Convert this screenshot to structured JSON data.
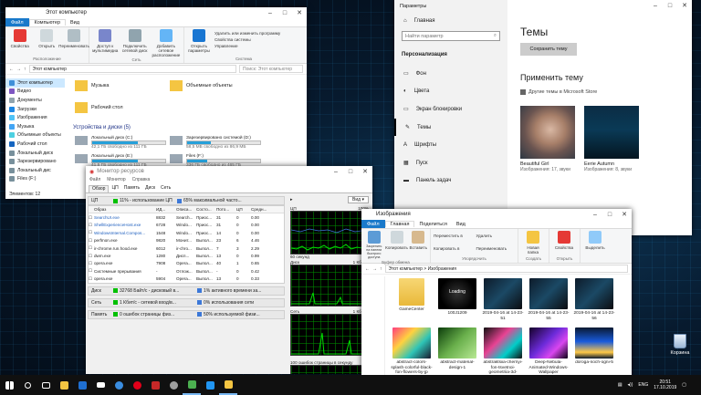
{
  "explorer1": {
    "title": "Этот компьютер",
    "tabs": [
      "Файл",
      "Компьютер",
      "Вид"
    ],
    "ribbon": {
      "location_items": [
        "Свойства",
        "Открыть",
        "Переименовать"
      ],
      "location_label": "Расположение",
      "net_items": [
        "Доступ к мультимедиа",
        "Подключить сетевой диск",
        "Добавить сетевое расположение"
      ],
      "net_label": "Сеть",
      "sys_open": "Открыть параметры",
      "sys_items": [
        "Удалить или изменить программу",
        "Свойства системы",
        "Управление"
      ],
      "sys_label": "Система"
    },
    "address": "Этот компьютер",
    "search_placeholder": "Поиск: Этот компьютер",
    "nav": [
      "Этот компьютер",
      "Видео",
      "Документы",
      "Загрузки",
      "Изображения",
      "Музыка",
      "Объемные объекты",
      "Рабочий стол",
      "Локальный диск",
      "Зарезервировано",
      "Локальный дис",
      "Files (F:)"
    ],
    "folders": [
      "Музыка",
      "Объемные объекты",
      "Рабочий стол"
    ],
    "devices_header": "Устройства и диски (5)",
    "drives": [
      {
        "name": "Локальный диск (C:)",
        "free": "42,1 ГБ свободно из 111 ГБ",
        "fill": 0.62
      },
      {
        "name": "Зарезервировано системой (D:)",
        "free": "58,5 МБ свободно из 86,9 МБ",
        "fill": 0.33
      },
      {
        "name": "Локальный диск (E:)",
        "free": "41,5 ГБ свободно из 111 ГБ",
        "fill": 0.63
      },
      {
        "name": "Files (F:)",
        "free": "336 ГБ свободно из 465 ГБ",
        "fill": 0.28
      }
    ],
    "status": "Элементов: 12"
  },
  "settings": {
    "title": "Параметры",
    "home": "Главная",
    "search_placeholder": "Найти параметр",
    "section": "Персонализация",
    "items": [
      "Фон",
      "Цвета",
      "Экран блокировки",
      "Темы",
      "Шрифты",
      "Пуск",
      "Панель задач"
    ],
    "heading": "Темы",
    "save_button": "Сохранить тему",
    "apply_heading": "Применить тему",
    "store_link": "Другие темы в Microsoft Store",
    "themes": [
      {
        "name": "Beautiful Girl",
        "sub": "Изображения: 17, звуки"
      },
      {
        "name": "Eerie Autumn",
        "sub": "Изображения: 8, звуки"
      }
    ]
  },
  "resmon": {
    "title": "Монитор ресурсов",
    "menu": [
      "Файл",
      "Монитор",
      "Справка"
    ],
    "tabs": [
      "Обзор",
      "ЦП",
      "Память",
      "Диск",
      "Сеть"
    ],
    "cpu_header": {
      "name": "ЦП",
      "usage": "11% - использование ЦП",
      "freq": "65% максимальной часто..."
    },
    "columns": [
      "Образ",
      "ИД...",
      "Описа...",
      "Состо...",
      "Пото...",
      "ЦП",
      "Средн..."
    ],
    "processes": [
      [
        "SearchUI.exe",
        "8832",
        "Search...",
        "Приос...",
        "31",
        "0",
        "0.00"
      ],
      [
        "ShellExperienceHost.exe",
        "6728",
        "Windo...",
        "Приос...",
        "31",
        "0",
        "0.00"
      ],
      [
        "WindowsInternal.Compos...",
        "1548",
        "Windo...",
        "Приос...",
        "14",
        "0",
        "0.00"
      ],
      [
        "perfmon.exe",
        "9820",
        "Монит...",
        "Выпол...",
        "23",
        "6",
        "4.46"
      ],
      [
        "ir-chrome.run.hood.exe",
        "6012",
        "ir-chro...",
        "Выпол...",
        "7",
        "3",
        "2.29"
      ],
      [
        "dwm.exe",
        "1280",
        "Дисп...",
        "Выпол...",
        "13",
        "0",
        "0.99"
      ],
      [
        "opera.exe",
        "7908",
        "Opera...",
        "Выпол...",
        "40",
        "1",
        "0.65"
      ],
      [
        "Системные прерывания",
        "-",
        "Отлож...",
        "Выпол...",
        "-",
        "0",
        "0.42"
      ],
      [
        "opera.exe",
        "5904",
        "Opera...",
        "Выпол...",
        "13",
        "0",
        "0.33"
      ]
    ],
    "disk_header": {
      "name": "Диск",
      "io": "32768 Байт/с - дисковый в...",
      "active": "1% активного времени за..."
    },
    "net_header": {
      "name": "Сеть",
      "io": "1 Кбит/с - сетевой вход/в...",
      "usage": "0% использования сети"
    },
    "mem_header": {
      "name": "Память",
      "faults": "0 ошибок страницы физ...",
      "used": "50% используемой физи..."
    },
    "view_button": "Вид",
    "graphs": [
      {
        "label": "ЦП",
        "max": "100%",
        "foot": "60 секунд",
        "end": "0%"
      },
      {
        "label": "Диск",
        "max": "1 Кбит/с",
        "foot": "",
        "end": ""
      },
      {
        "label": "Сеть",
        "max": "1 Кбит/с",
        "foot": "",
        "end": "0"
      },
      {
        "label": "100 ошибок страницы в секунду",
        "max": "",
        "foot": "",
        "end": ""
      }
    ]
  },
  "explorer2": {
    "title": "Изображения",
    "tabs": [
      "Файл",
      "Главная",
      "Поделиться",
      "Вид"
    ],
    "ribbon": {
      "clipboard": [
        "Закрепить на панели быстрого доступа",
        "Копировать",
        "Вставить"
      ],
      "clipboard_label": "Буфер обмена",
      "organize": [
        "Переместить в",
        "Копировать в",
        "Удалить",
        "Переименовать"
      ],
      "organize_label": "Упорядочить",
      "new": [
        "Новая папка"
      ],
      "new_label": "Создать",
      "open": [
        "Свойства"
      ],
      "open_label": "Открыть",
      "select": [
        "Выделить"
      ]
    },
    "address": "Этот компьютер > Изображения",
    "files": [
      {
        "name": "GameCenter",
        "kind": "folder"
      },
      {
        "name": "100J1209",
        "kind": "loading"
      },
      {
        "name": "2019-04-16 at 14-23-51",
        "kind": "dark"
      },
      {
        "name": "2019-04-16 at 14-23-55",
        "kind": "dark"
      },
      {
        "name": "2019-04-16 at 14-23-56",
        "kind": "dark"
      },
      {
        "name": "abstract-colors-splash-colorful-black-fon-flowers-by-jp",
        "kind": "colorful"
      },
      {
        "name": "abstract-material-design-1",
        "kind": "green"
      },
      {
        "name": "abstraktsiia-chernyi-fon-tsvetnoi-geometriia-3d-abstract-ge",
        "kind": "geo"
      },
      {
        "name": "Deep-Nebula-Animated-Windows-Wallpaper",
        "kind": "nebula"
      },
      {
        "name": "doroga-noch-ogni-5",
        "kind": "road"
      }
    ]
  },
  "desktop": {
    "recycle_bin": "Корзина"
  },
  "taskbar": {
    "icons": [
      "start-icon",
      "search-icon",
      "taskview-icon",
      "explorer-icon",
      "store-icon",
      "mail-icon",
      "edge-icon",
      "opera-icon",
      "vpn-icon",
      "settings-icon",
      "resmon-icon",
      "photos-icon",
      "folder-icon"
    ],
    "lang": "ENG",
    "time": "20:51",
    "date": "17.10.2019"
  },
  "colors": {
    "accent": "#1979ca",
    "cpu_green": "#00c000",
    "memory_blue": "#3c78d8"
  }
}
